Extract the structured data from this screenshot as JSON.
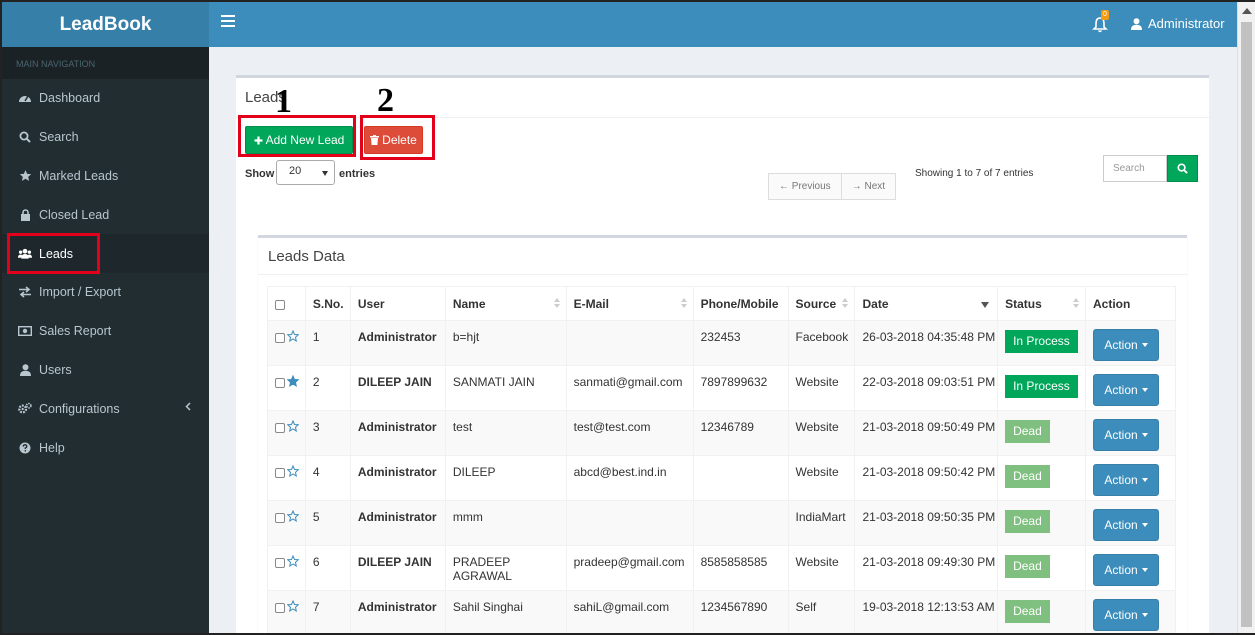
{
  "app": {
    "logo": "LeadBook",
    "notification_count": "0",
    "user_name": "Administrator"
  },
  "sidebar": {
    "header": "MAIN NAVIGATION",
    "items": [
      {
        "label": "Dashboard",
        "icon": "dashboard-icon"
      },
      {
        "label": "Search",
        "icon": "search-icon"
      },
      {
        "label": "Marked Leads",
        "icon": "star-icon"
      },
      {
        "label": "Closed Lead",
        "icon": "lock-icon"
      },
      {
        "label": "Leads",
        "icon": "users-icon"
      },
      {
        "label": "Import / Export",
        "icon": "exchange-icon"
      },
      {
        "label": "Sales Report",
        "icon": "money-icon"
      },
      {
        "label": "Users",
        "icon": "user-icon"
      },
      {
        "label": "Configurations",
        "icon": "gears-icon"
      },
      {
        "label": "Help",
        "icon": "question-icon"
      }
    ],
    "active": "Leads"
  },
  "page": {
    "title": "Leads",
    "add_button": "Add New Lead",
    "delete_button": "Delete",
    "annotation_1": "1",
    "annotation_2": "2",
    "show_label": "Show",
    "page_size": "20",
    "entries_label": "entries",
    "prev_label": "← Previous",
    "next_label": "→ Next",
    "showing_text": "Showing 1 to 7 of 7 entries",
    "search_placeholder": "Search"
  },
  "leads": {
    "title": "Leads Data",
    "columns": [
      "S.No.",
      "User",
      "Name",
      "E-Mail",
      "Phone/Mobile",
      "Source",
      "Date",
      "Status",
      "Action"
    ],
    "rows": [
      {
        "sno": "1",
        "user": "Administrator",
        "name": "b=hjt",
        "email": "",
        "phone": "232453",
        "source": "Facebook",
        "date": "26-03-2018 04:35:48 PM",
        "status": "In Process",
        "starred": false,
        "action": "Action"
      },
      {
        "sno": "2",
        "user": "DILEEP JAIN",
        "name": "SANMATI JAIN",
        "email": "sanmati@gmail.com",
        "phone": "7897899632",
        "source": "Website",
        "date": "22-03-2018 09:03:51 PM",
        "status": "In Process",
        "starred": true,
        "action": "Action"
      },
      {
        "sno": "3",
        "user": "Administrator",
        "name": "test",
        "email": "test@test.com",
        "phone": "12346789",
        "source": "Website",
        "date": "21-03-2018 09:50:49 PM",
        "status": "Dead",
        "starred": false,
        "action": "Action"
      },
      {
        "sno": "4",
        "user": "Administrator",
        "name": "DILEEP",
        "email": "abcd@best.ind.in",
        "phone": "",
        "source": "Website",
        "date": "21-03-2018 09:50:42 PM",
        "status": "Dead",
        "starred": false,
        "action": "Action"
      },
      {
        "sno": "5",
        "user": "Administrator",
        "name": "mmm",
        "email": "",
        "phone": "",
        "source": "IndiaMart",
        "date": "21-03-2018 09:50:35 PM",
        "status": "Dead",
        "starred": false,
        "action": "Action"
      },
      {
        "sno": "6",
        "user": "DILEEP JAIN",
        "name": "PRADEEP AGRAWAL",
        "email": "pradeep@gmail.com",
        "phone": "8585858585",
        "source": "Website",
        "date": "21-03-2018 09:49:30 PM",
        "status": "Dead",
        "starred": false,
        "action": "Action"
      },
      {
        "sno": "7",
        "user": "Administrator",
        "name": "Sahil Singhai",
        "email": "sahiL@gmail.com",
        "phone": "1234567890",
        "source": "Self",
        "date": "19-03-2018 12:13:53 AM",
        "status": "Dead",
        "starred": false,
        "action": "Action"
      }
    ]
  },
  "colors": {
    "header": "#3c8dbc",
    "logo_bg": "#367fa9",
    "sidebar": "#222d32",
    "success": "#00a65a",
    "danger": "#dd4b39",
    "dead": "#7fbf7f",
    "highlight": "#e3001b"
  }
}
